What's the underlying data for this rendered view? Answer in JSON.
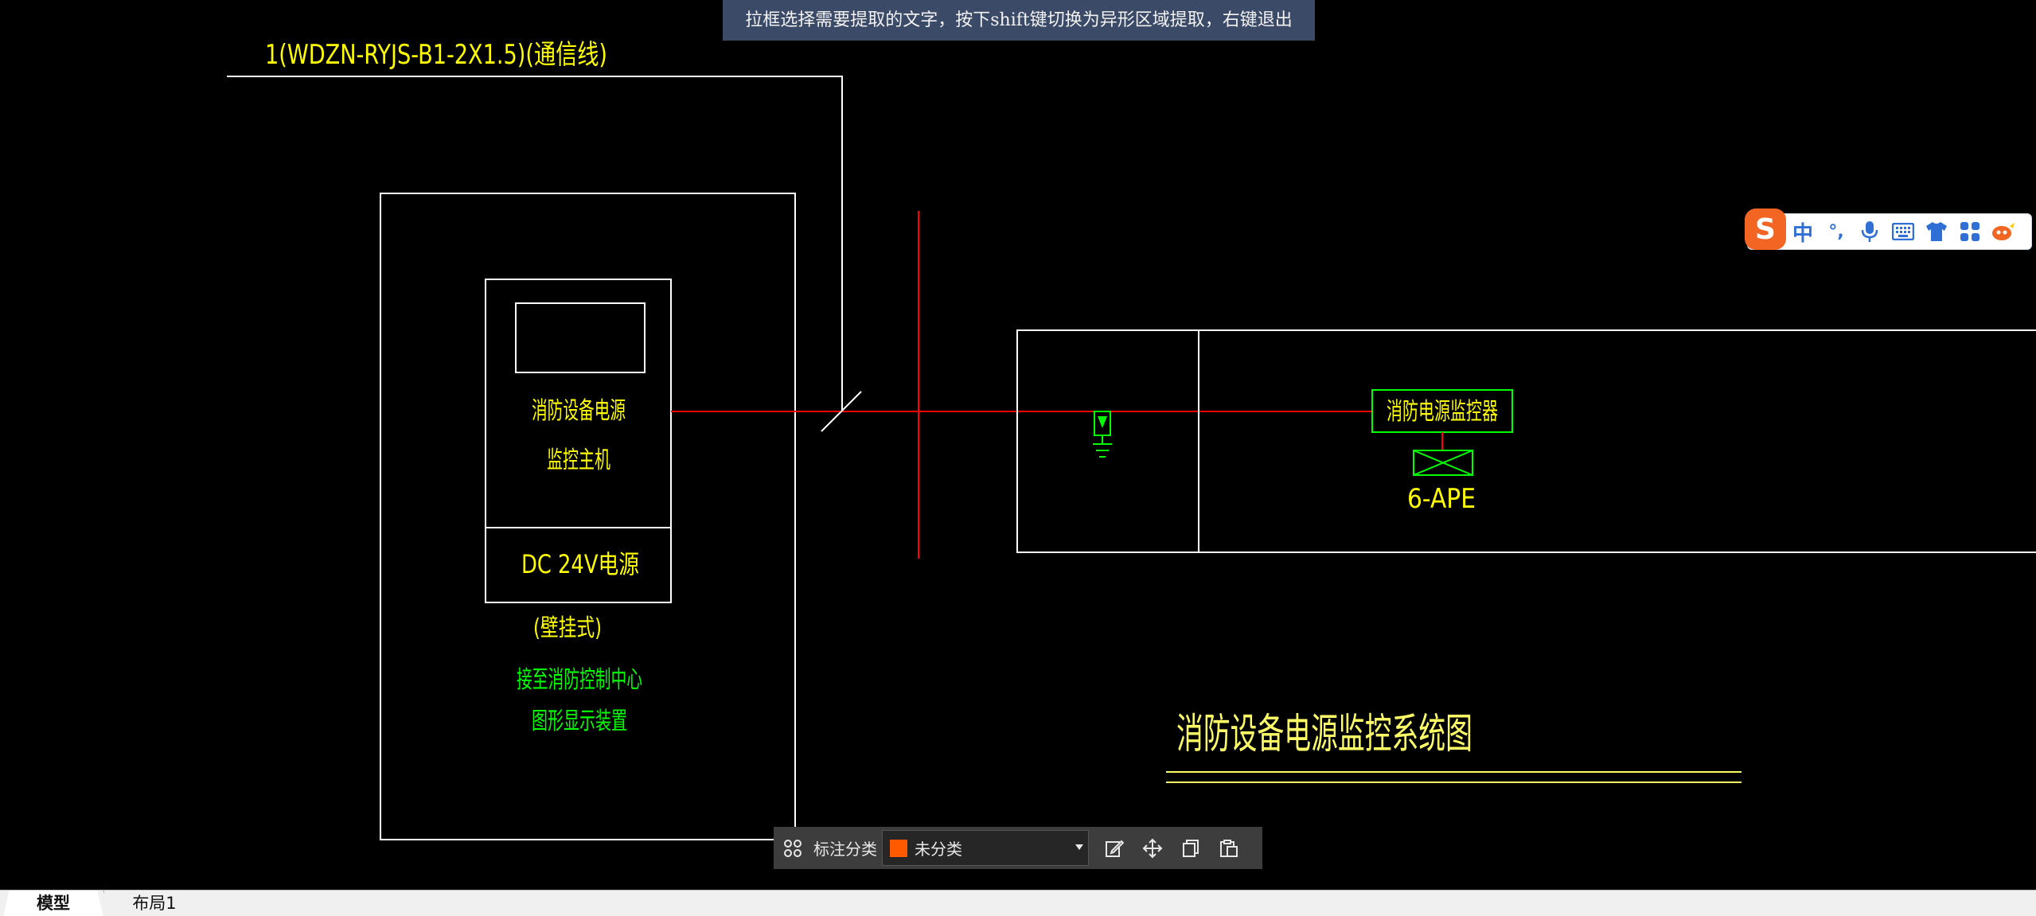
{
  "hint_banner": {
    "text": "拉框选择需要提取的文字，按下shift键切换为异形区域提取，右键退出"
  },
  "drawing": {
    "cable_label": "1(WDZN-RYJS-B1-2X1.5)(通信线)",
    "host_label_line1": "消防设备电源",
    "host_label_line2": "监控主机",
    "power_label": "DC 24V电源",
    "mount_label": "(壁挂式)",
    "connect_label_line1": "接至消防控制中心",
    "connect_label_line2": "图形显示装置",
    "monitor_label": "消防电源监控器",
    "device_label": "6-APE",
    "system_title": "消防设备电源监控系统图",
    "colors": {
      "white": "#ffffff",
      "yellow": "#ffff00",
      "green": "#00ff00",
      "red": "#ff0000",
      "title_yellow": "#ffff66"
    }
  },
  "ime_toolbar": {
    "logo": "S",
    "mode_label": "中",
    "punct_label": "°,",
    "icons": [
      "microphone-icon",
      "keyboard-icon",
      "skin-shirt-icon",
      "toolbox-icon",
      "mascot-icon"
    ],
    "logo_color": "#f26522",
    "icon_color": "#2f6fd6"
  },
  "annotation_toolbar": {
    "label": "标注分类",
    "selected_category": "未分类",
    "swatch_color": "#ff5a00",
    "icons": [
      "grid-icon",
      "edit-icon",
      "move-icon",
      "copy-icon",
      "paste-icon"
    ]
  },
  "tabs": [
    {
      "label": "模型",
      "active": true
    },
    {
      "label": "布局1",
      "active": false
    }
  ]
}
